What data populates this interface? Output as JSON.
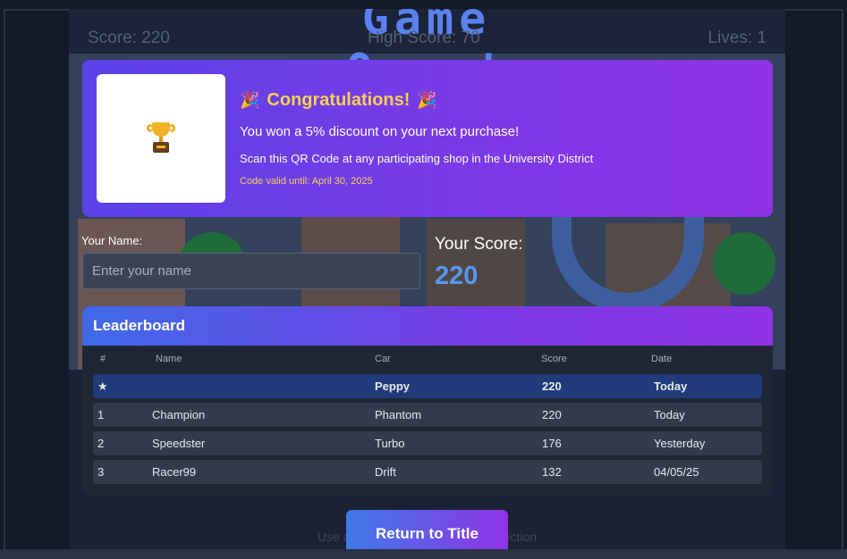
{
  "hud": {
    "title": "Game Over!",
    "score": "Score: 220",
    "high_score": "High Score: 70",
    "lives": "Lives: 1",
    "hint": "Use arrow keys to steer in any direction"
  },
  "promo": {
    "heading": "Congratulations!",
    "line1": "You won a 5% discount on your next purchase!",
    "line2": "Scan this QR Code at any participating shop in the University District",
    "line3": "Code valid until: April 30, 2025",
    "party_icon": "🎉",
    "image_icon": "trophy-icon"
  },
  "form": {
    "name_label": "Your Name:",
    "name_placeholder": "Enter your name",
    "name_value": "",
    "score_label": "Your Score:",
    "score_value": "220"
  },
  "leaderboard": {
    "title": "Leaderboard",
    "columns": [
      "#",
      "Name",
      "Car",
      "Score",
      "Date"
    ],
    "current": {
      "rank": "★",
      "name": "",
      "car": "Peppy",
      "score": "220",
      "date": "Today"
    },
    "rows": [
      {
        "rank": "1",
        "name": "Champion",
        "car": "Phantom",
        "score": "220",
        "date": "Today"
      },
      {
        "rank": "2",
        "name": "Speedster",
        "car": "Turbo",
        "score": "176",
        "date": "Yesterday"
      },
      {
        "rank": "3",
        "name": "Racer99",
        "car": "Drift",
        "score": "132",
        "date": "04/05/25"
      }
    ]
  },
  "actions": {
    "return_label": "Return to Title"
  },
  "colors": {
    "accent_purple": "#8f33e6",
    "accent_blue": "#3f6ae8",
    "highlight_yellow": "#f7d154",
    "score_blue": "#5b97f0"
  }
}
